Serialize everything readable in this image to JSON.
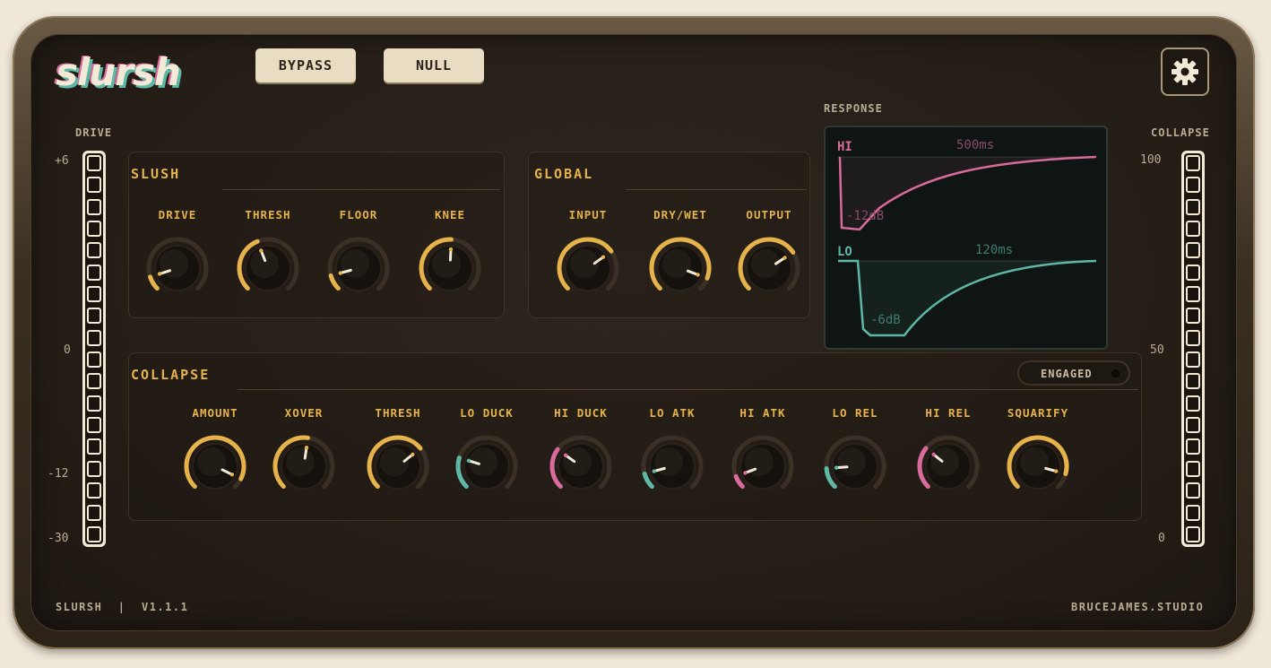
{
  "app": {
    "logo": "slursh"
  },
  "top_buttons": {
    "bypass": "BYPASS",
    "null": "NULL"
  },
  "icons": {
    "settings": "gear-icon"
  },
  "meters": {
    "drive": {
      "label": "DRIVE",
      "scale": [
        "+6",
        "0",
        "-12",
        "-30"
      ]
    },
    "collapse": {
      "label": "COLLAPSE",
      "scale": [
        "100",
        "50",
        "0"
      ]
    }
  },
  "slush": {
    "title": "SLUSH",
    "knobs": [
      {
        "label": "DRIVE",
        "value": 0.1,
        "color": "#e6b24a",
        "mode": "uni"
      },
      {
        "label": "THRESH",
        "value": 0.42,
        "color": "#e6b24a",
        "mode": "uni"
      },
      {
        "label": "FLOOR",
        "value": 0.11,
        "color": "#e6b24a",
        "mode": "uni"
      },
      {
        "label": "KNEE",
        "value": 0.51,
        "color": "#e6b24a",
        "mode": "uni"
      }
    ]
  },
  "global": {
    "title": "GLOBAL",
    "knobs": [
      {
        "label": "INPUT",
        "value": 0.7,
        "color": "#e6b24a",
        "mode": "uni"
      },
      {
        "label": "DRY/WET",
        "value": 0.91,
        "color": "#e6b24a",
        "mode": "uni"
      },
      {
        "label": "OUTPUT",
        "value": 0.71,
        "color": "#e6b24a",
        "mode": "uni"
      }
    ]
  },
  "response": {
    "label": "RESPONSE",
    "hi": {
      "label": "HI",
      "time": "500ms",
      "gain": "-12dB",
      "color": "#d96a9c"
    },
    "lo": {
      "label": "LO",
      "time": "120ms",
      "gain": "-6dB",
      "color": "#5fb8a6"
    }
  },
  "collapse": {
    "title": "COLLAPSE",
    "engaged": "ENGAGED",
    "knobs": [
      {
        "label": "AMOUNT",
        "value": 0.93,
        "color": "#e6b24a",
        "mode": "uni"
      },
      {
        "label": "XOVER",
        "value": 0.53,
        "color": "#e6b24a",
        "mode": "uni"
      },
      {
        "label": "THRESH",
        "value": 0.69,
        "color": "#e6b24a",
        "mode": "uni"
      },
      {
        "label": "LO DUCK",
        "value": 0.23,
        "color": "#5fb8a6",
        "mode": "uni"
      },
      {
        "label": "HI DUCK",
        "value": 0.3,
        "color": "#d96a9c",
        "mode": "uni"
      },
      {
        "label": "LO ATK",
        "value": 0.11,
        "color": "#5fb8a6",
        "mode": "uni"
      },
      {
        "label": "HI ATK",
        "value": 0.09,
        "color": "#d96a9c",
        "mode": "uni"
      },
      {
        "label": "LO REL",
        "value": 0.15,
        "color": "#5fb8a6",
        "mode": "uni"
      },
      {
        "label": "HI REL",
        "value": 0.31,
        "color": "#d96a9c",
        "mode": "uni"
      },
      {
        "label": "SQUARIFY",
        "value": 0.89,
        "color": "#e6b24a",
        "mode": "uni"
      }
    ]
  },
  "footer": {
    "left": "SLURSH  |  V1.1.1",
    "right": "BRUCEJAMES.STUDIO"
  }
}
